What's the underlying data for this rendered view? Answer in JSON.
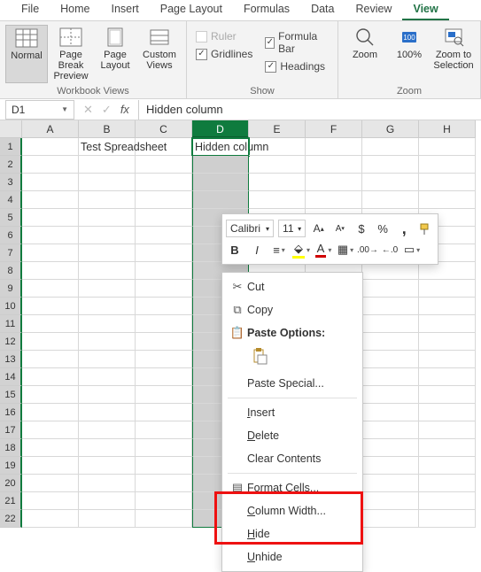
{
  "tabs": [
    "File",
    "Home",
    "Insert",
    "Page Layout",
    "Formulas",
    "Data",
    "Review",
    "View"
  ],
  "active_tab": "View",
  "ribbon": {
    "views_group": {
      "label": "Workbook Views",
      "normal": "Normal",
      "pagebreak": "Page Break Preview",
      "pagelayout": "Page Layout",
      "custom": "Custom Views"
    },
    "show_group": {
      "label": "Show",
      "ruler": "Ruler",
      "formula_bar": "Formula Bar",
      "gridlines": "Gridlines",
      "headings": "Headings"
    },
    "zoom_group": {
      "label": "Zoom",
      "zoom": "Zoom",
      "p100": "100%",
      "zts": "Zoom to Selection"
    }
  },
  "namebox": "D1",
  "formula_bar": "Hidden column",
  "columns": [
    "A",
    "B",
    "C",
    "D",
    "E",
    "F",
    "G",
    "H"
  ],
  "selected_col_index": 3,
  "cells": {
    "b1": "Test Spreadsheet",
    "d1": "Hidden column"
  },
  "minitb": {
    "font": "Calibri",
    "size": "11",
    "bold": "B",
    "italic": "I"
  },
  "ctx": {
    "cut": "Cut",
    "copy": "Copy",
    "paste_opts": "Paste Options:",
    "paste_special": "Paste Special...",
    "insert": "Insert",
    "delete": "Delete",
    "clear": "Clear Contents",
    "format": "Format Cells...",
    "colwidth": "Column Width...",
    "hide": "Hide",
    "unhide": "Unhide"
  }
}
